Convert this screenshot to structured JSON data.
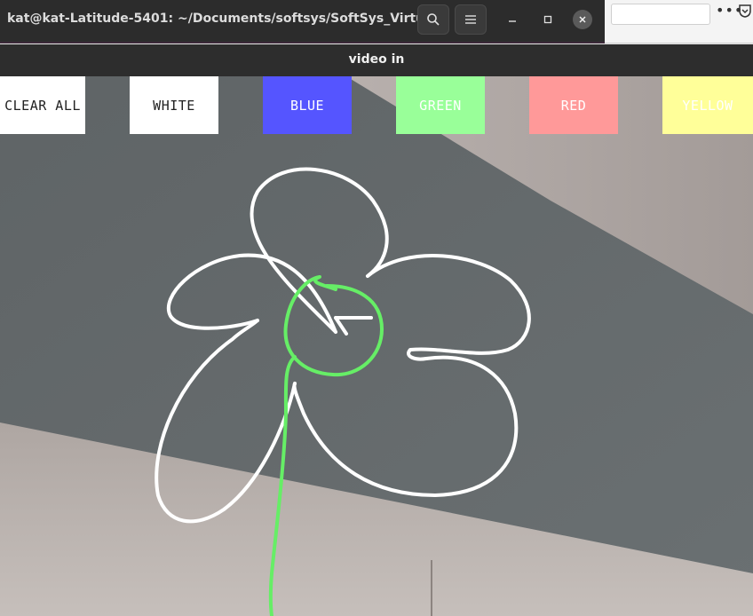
{
  "terminal": {
    "title": "kat@kat-Latitude-5401: ~/Documents/softsys/SoftSys_Virtu…",
    "search_icon": "search-icon",
    "menu_icon": "hamburger-menu-icon",
    "minimize_icon": "minimize-icon",
    "maximize_icon": "maximize-icon",
    "close_icon": "close-icon"
  },
  "browser": {
    "menu_dots": "•••"
  },
  "video_window": {
    "title": "video in"
  },
  "color_buttons": [
    {
      "label": "CLEAR ALL",
      "bg": "#ffffff",
      "fg": "#222222"
    },
    {
      "label": "WHITE",
      "bg": "#ffffff",
      "fg": "#222222"
    },
    {
      "label": "BLUE",
      "bg": "#5555ff",
      "fg": "#ffffff"
    },
    {
      "label": "GREEN",
      "bg": "#99ff99",
      "fg": "#ffffff"
    },
    {
      "label": "RED",
      "bg": "#ff9999",
      "fg": "#ffffff"
    },
    {
      "label": "YELLOW",
      "bg": "#ffff99",
      "fg": "#ffffff"
    }
  ],
  "drawing": {
    "white_stroke": "#ffffff",
    "green_stroke": "#66ee66"
  }
}
